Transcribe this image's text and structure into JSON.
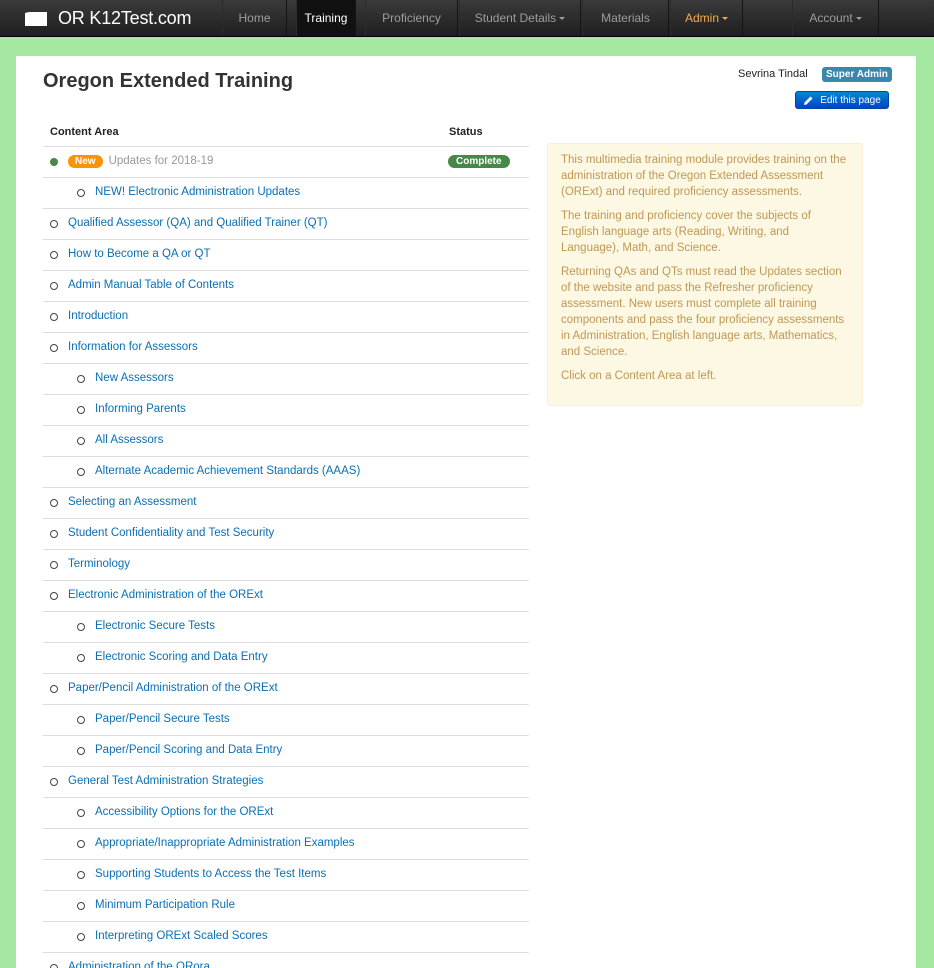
{
  "navbar": {
    "brand": "OR K12Test.com",
    "items": [
      {
        "label": "Home",
        "active": false
      },
      {
        "label": "Training",
        "active": true
      },
      {
        "label": "Proficiency",
        "active": false
      },
      {
        "label": "Student Details",
        "active": false,
        "dropdown": true
      },
      {
        "label": "Materials",
        "active": false
      },
      {
        "label": "Admin",
        "active": false,
        "dropdown": true,
        "color": "#f0ad4e"
      },
      {
        "label": "Account",
        "active": false,
        "dropdown": true
      }
    ]
  },
  "page": {
    "title": "Oregon Extended Training",
    "user_name": "Sevrina Tindal",
    "role": "Super Admin",
    "edit_label": "Edit this page"
  },
  "table": {
    "col_content": "Content Area",
    "col_status": "Status",
    "rows": [
      {
        "level": 0,
        "label": "Updates for 2018-19",
        "badge": "New",
        "status": "Complete",
        "filled": true,
        "muted": true
      },
      {
        "level": 1,
        "label": "NEW! Electronic Administration Updates"
      },
      {
        "level": 0,
        "label": "Qualified Assessor (QA) and Qualified Trainer (QT)"
      },
      {
        "level": 0,
        "label": "How to Become a QA or QT"
      },
      {
        "level": 0,
        "label": "Admin Manual Table of Contents"
      },
      {
        "level": 0,
        "label": "Introduction"
      },
      {
        "level": 0,
        "label": "Information for Assessors"
      },
      {
        "level": 1,
        "label": "New Assessors"
      },
      {
        "level": 1,
        "label": "Informing Parents"
      },
      {
        "level": 1,
        "label": "All Assessors"
      },
      {
        "level": 1,
        "label": "Alternate Academic Achievement Standards (AAAS)"
      },
      {
        "level": 0,
        "label": "Selecting an Assessment"
      },
      {
        "level": 0,
        "label": "Student Confidentiality and Test Security"
      },
      {
        "level": 0,
        "label": "Terminology"
      },
      {
        "level": 0,
        "label": "Electronic Administration of the ORExt"
      },
      {
        "level": 1,
        "label": "Electronic Secure Tests"
      },
      {
        "level": 1,
        "label": "Electronic Scoring and Data Entry"
      },
      {
        "level": 0,
        "label": "Paper/Pencil Administration of the ORExt"
      },
      {
        "level": 1,
        "label": "Paper/Pencil Secure Tests"
      },
      {
        "level": 1,
        "label": "Paper/Pencil Scoring and Data Entry"
      },
      {
        "level": 0,
        "label": "General Test Administration Strategies"
      },
      {
        "level": 1,
        "label": "Accessibility Options for the ORExt"
      },
      {
        "level": 1,
        "label": "Appropriate/Inappropriate Administration Examples"
      },
      {
        "level": 1,
        "label": "Supporting Students to Access the Test Items"
      },
      {
        "level": 1,
        "label": "Minimum Participation Rule"
      },
      {
        "level": 1,
        "label": "Interpreting ORExt Scaled Scores"
      },
      {
        "level": 0,
        "label": "Administration of the ORora"
      }
    ]
  },
  "info": {
    "paragraphs": [
      "This multimedia training module provides training on the administration of the Oregon Extended Assessment (ORExt) and required proficiency assessments.",
      "The training and proficiency cover the subjects of English language arts (Reading, Writing, and Language), Math, and Science.",
      "Returning QAs and QTs must read the Updates section of the website and pass the Refresher proficiency assessment. New users must complete all training components and pass the four proficiency assessments in Administration, English language arts, Mathematics, and Science.",
      "Click on a Content Area at left."
    ]
  },
  "colors": {
    "background": "#a5e8a1",
    "link": "#0a6fb4",
    "new_badge": "#f89406",
    "complete_badge": "#468847",
    "info_text": "#c09853"
  }
}
